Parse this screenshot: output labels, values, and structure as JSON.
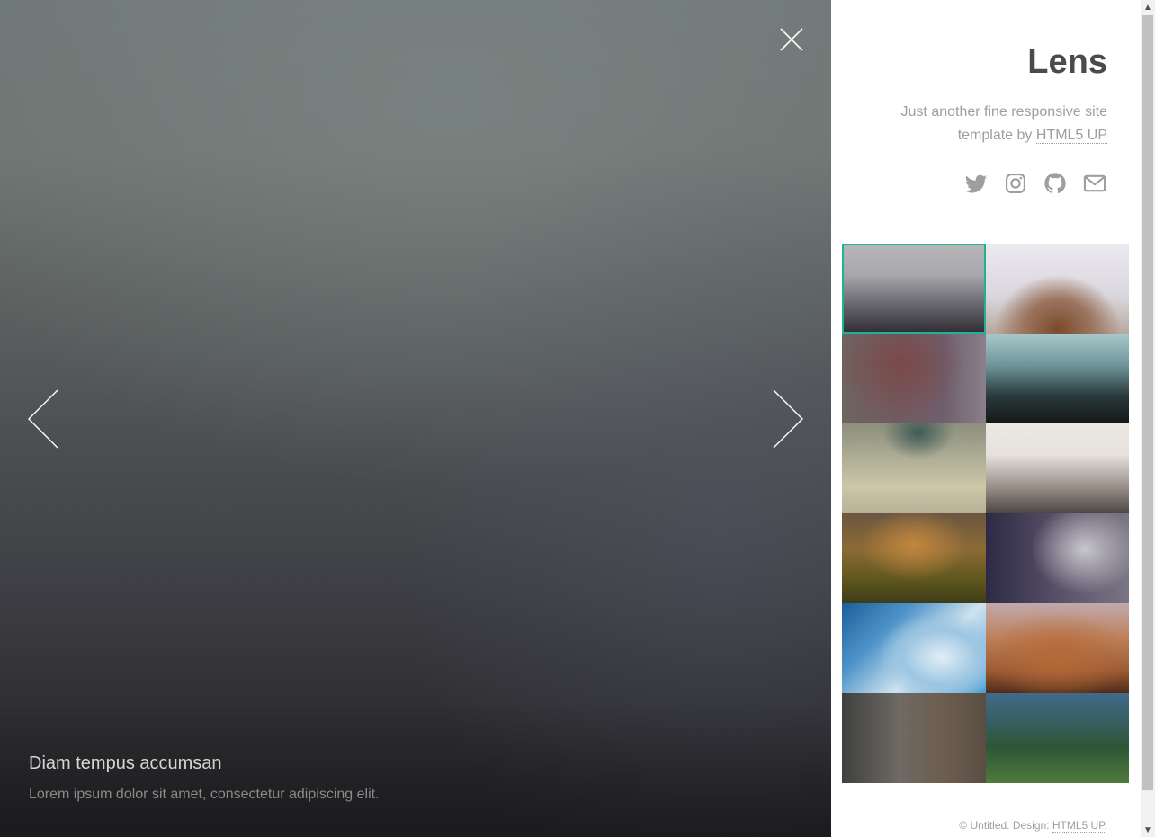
{
  "viewer": {
    "caption_title": "Diam tempus accumsan",
    "caption_text": "Lorem ipsum dolor sit amet, consectetur adipiscing elit.",
    "close_icon": "close-icon",
    "prev_icon": "chevron-left-icon",
    "next_icon": "chevron-right-icon"
  },
  "sidebar": {
    "title": "Lens",
    "tagline_prefix": "Just another fine responsive site template by",
    "tagline_link": "HTML5 UP",
    "social": [
      "twitter-icon",
      "instagram-icon",
      "github-icon",
      "envelope-icon"
    ],
    "thumbnails": [
      {
        "active": true
      },
      {
        "active": false
      },
      {
        "active": false
      },
      {
        "active": false
      },
      {
        "active": false
      },
      {
        "active": false
      },
      {
        "active": false
      },
      {
        "active": false
      },
      {
        "active": false
      },
      {
        "active": false
      },
      {
        "active": false
      },
      {
        "active": false
      }
    ],
    "footer_prefix": "© Untitled.  Design:",
    "footer_link": "HTML5 UP",
    "footer_suffix": "."
  },
  "colors": {
    "accent": "#1cb495",
    "title": "#4b4b4b",
    "muted_text": "#9e9e9e"
  }
}
